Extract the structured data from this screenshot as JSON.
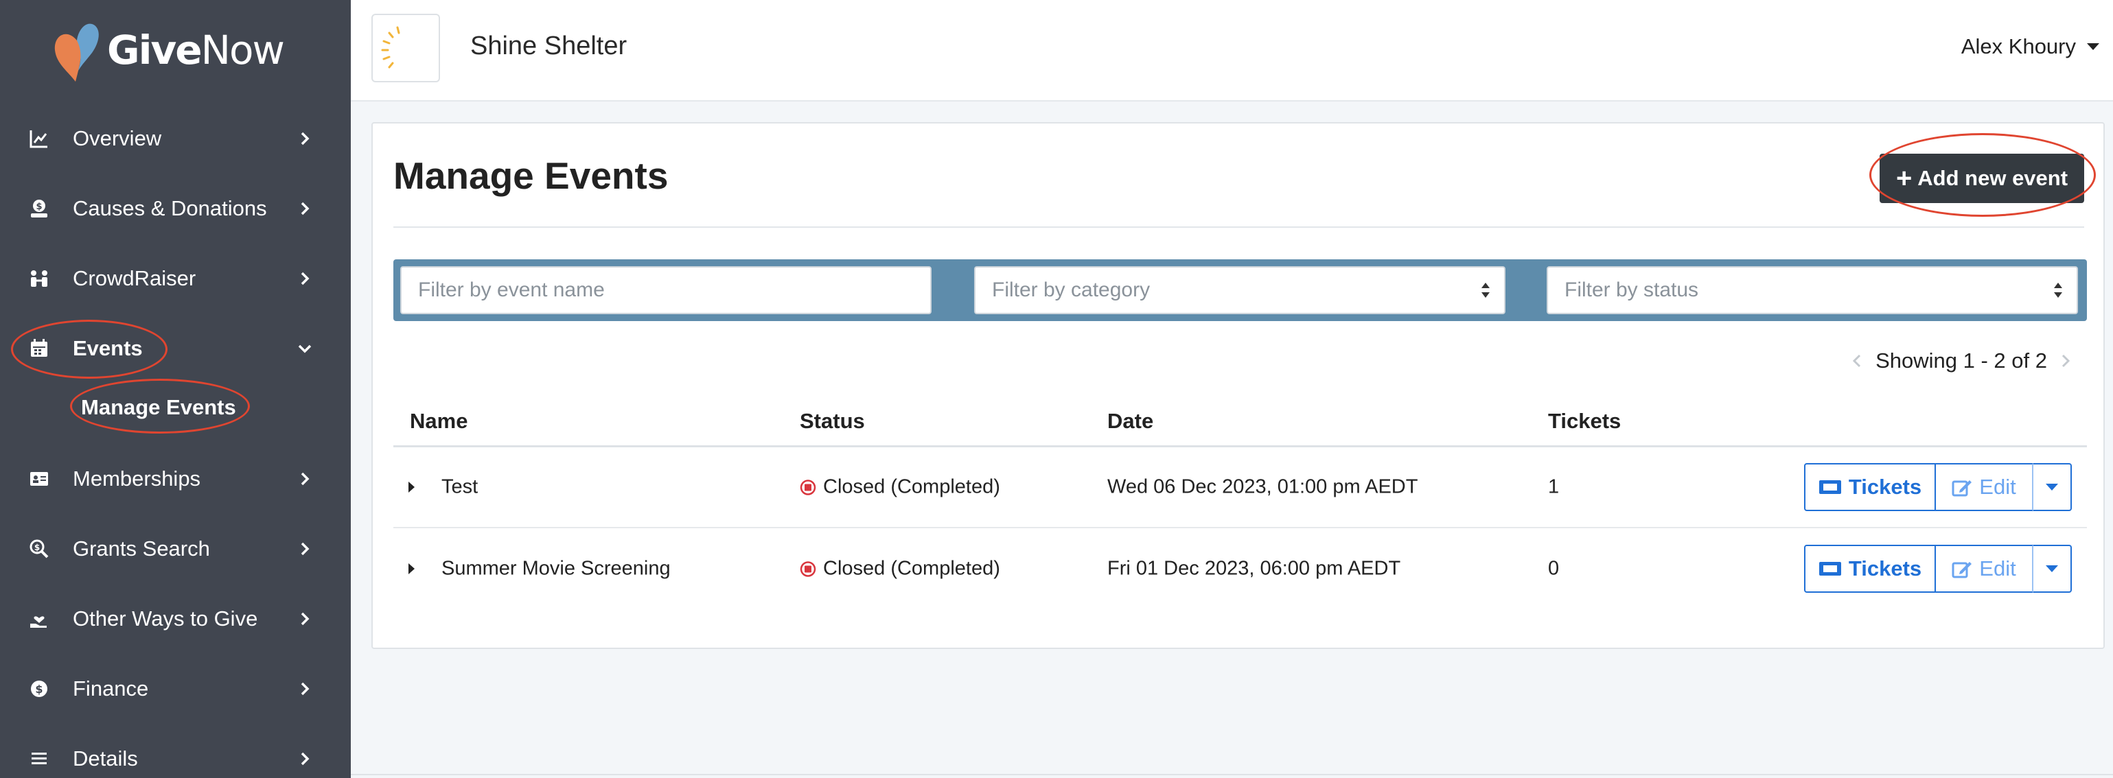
{
  "app": {
    "logo_text_bold": "Give",
    "logo_text_rest": "Now",
    "brand_colors": {
      "heart_orange": "#e8824e",
      "heart_blue": "#6aa3cf"
    }
  },
  "sidebar": {
    "items": [
      {
        "label": "Overview",
        "icon": "chart-line-icon"
      },
      {
        "label": "Causes & Donations",
        "icon": "donation-icon"
      },
      {
        "label": "CrowdRaiser",
        "icon": "crowd-icon"
      },
      {
        "label": "Events",
        "icon": "calendar-icon",
        "expanded": true
      },
      {
        "label": "Memberships",
        "icon": "id-card-icon"
      },
      {
        "label": "Grants Search",
        "icon": "search-dollar-icon"
      },
      {
        "label": "Other Ways to Give",
        "icon": "hand-heart-icon"
      },
      {
        "label": "Finance",
        "icon": "coin-icon"
      },
      {
        "label": "Details",
        "icon": "list-icon"
      }
    ],
    "subitems": {
      "events": [
        {
          "label": "Manage Events",
          "active": true
        }
      ]
    }
  },
  "header": {
    "org_name": "Shine Shelter",
    "user_name": "Alex Khoury"
  },
  "main": {
    "title": "Manage Events",
    "add_button": "Add new event",
    "filters": {
      "name_placeholder": "Filter by event name",
      "category_placeholder": "Filter by category",
      "status_placeholder": "Filter by status"
    },
    "paging": "Showing 1 - 2 of 2",
    "columns": {
      "name": "Name",
      "status": "Status",
      "date": "Date",
      "tickets": "Tickets"
    },
    "rows": [
      {
        "name": "Test",
        "status": "Closed (Completed)",
        "date": "Wed 06 Dec 2023, 01:00 pm AEDT",
        "tickets": "1"
      },
      {
        "name": "Summer Movie Screening",
        "status": "Closed (Completed)",
        "date": "Fri 01 Dec 2023, 06:00 pm AEDT",
        "tickets": "0"
      }
    ],
    "row_actions": {
      "tickets": "Tickets",
      "edit": "Edit"
    }
  },
  "colors": {
    "sidebar_bg": "#414650",
    "filter_bar": "#5e8cab",
    "primary": "#1f6fd6",
    "dark_button": "#343a40",
    "status_closed": "#d9363e",
    "annotation": "#e04530"
  }
}
